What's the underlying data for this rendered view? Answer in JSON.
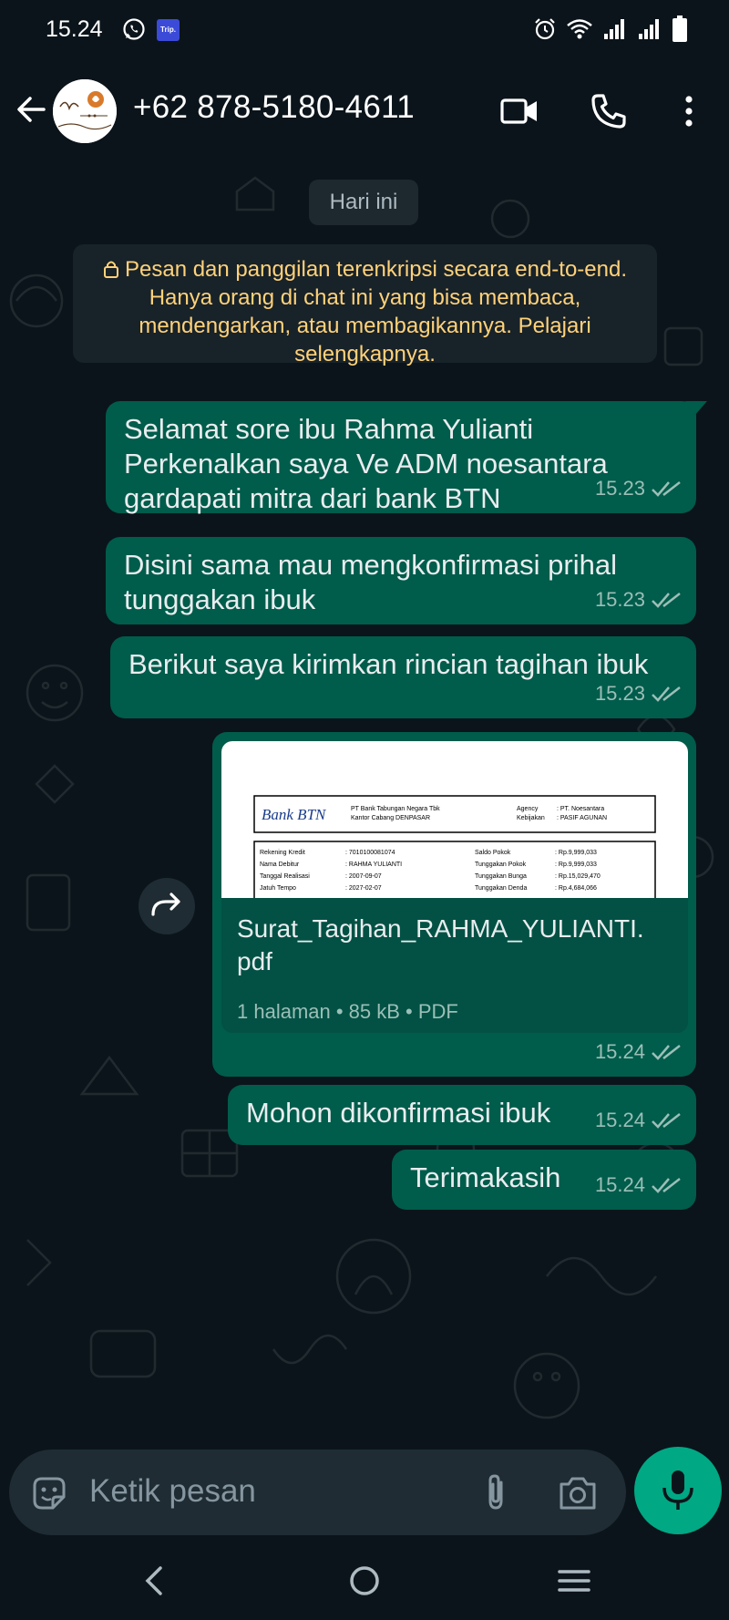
{
  "status_bar": {
    "time": "15.24",
    "trip_badge": "Trip."
  },
  "header": {
    "contact": "+62 878-5180-4611"
  },
  "chat": {
    "date_chip": "Hari ini",
    "encryption_note": "Pesan dan panggilan terenkripsi secara end-to-end. Hanya orang di chat ini yang bisa membaca, mendengarkan, atau membagikannya. Pelajari selengkapnya.",
    "messages": [
      {
        "text_lines": [
          "Selamat sore ibu Rahma Yulianti",
          "Perkenalkan saya Ve ADM noesantara",
          "gardapati mitra dari bank BTN"
        ],
        "time": "15.23"
      },
      {
        "text_lines": [
          "Disini sama mau mengkonfirmasi prihal",
          "tunggakan ibuk"
        ],
        "time": "15.23"
      },
      {
        "text_lines": [
          "Berikut saya kirimkan rincian tagihan ibuk"
        ],
        "time": "15.23"
      },
      {
        "document": {
          "name_lines": [
            "Surat_Tagihan_RAHMA_YULIANTI.",
            "pdf"
          ],
          "info": "1 halaman • 85 kB • PDF"
        },
        "time": "15.24"
      },
      {
        "text_lines": [
          "Mohon dikonfirmasi ibuk"
        ],
        "time": "15.24"
      },
      {
        "text_lines": [
          "Terimakasih"
        ],
        "time": "15.24"
      }
    ],
    "doc_preview": {
      "bank_logo": "Bank BTN",
      "bank_name": "PT Bank Tabungan Negara Tbk",
      "branch": "Kantor Cabang DENPASAR",
      "agency_label": "Agency",
      "agency_value": ": PT. Noesantara",
      "policy_label": "Kebijakan",
      "policy_value": ": PASIF AGUNAN",
      "rows": [
        {
          "label": "Rekening Kredit",
          "value": ": 7010100081074",
          "label2": "Saldo Pokok",
          "value2": ": Rp.9,999,033"
        },
        {
          "label": "Nama Debitur",
          "value": ": RAHMA YULIANTI",
          "label2": "Tunggakan Pokok",
          "value2": ": Rp.9,999,033"
        },
        {
          "label": "Tanggal Realisasi",
          "value": ": 2007-09-07",
          "label2": "Tunggakan Bunga",
          "value2": ": Rp.15,029,470"
        },
        {
          "label": "Jatuh Tempo",
          "value": ": 2027-02-07",
          "label2": "Tunggakan Denda",
          "value2": ": Rp.4,684,066"
        }
      ]
    }
  },
  "input": {
    "placeholder": "Ketik pesan"
  },
  "colors": {
    "bubble_out": "#005c4b",
    "background": "#0b141a",
    "accent": "#00a884",
    "system_note_text": "#ffd279"
  }
}
